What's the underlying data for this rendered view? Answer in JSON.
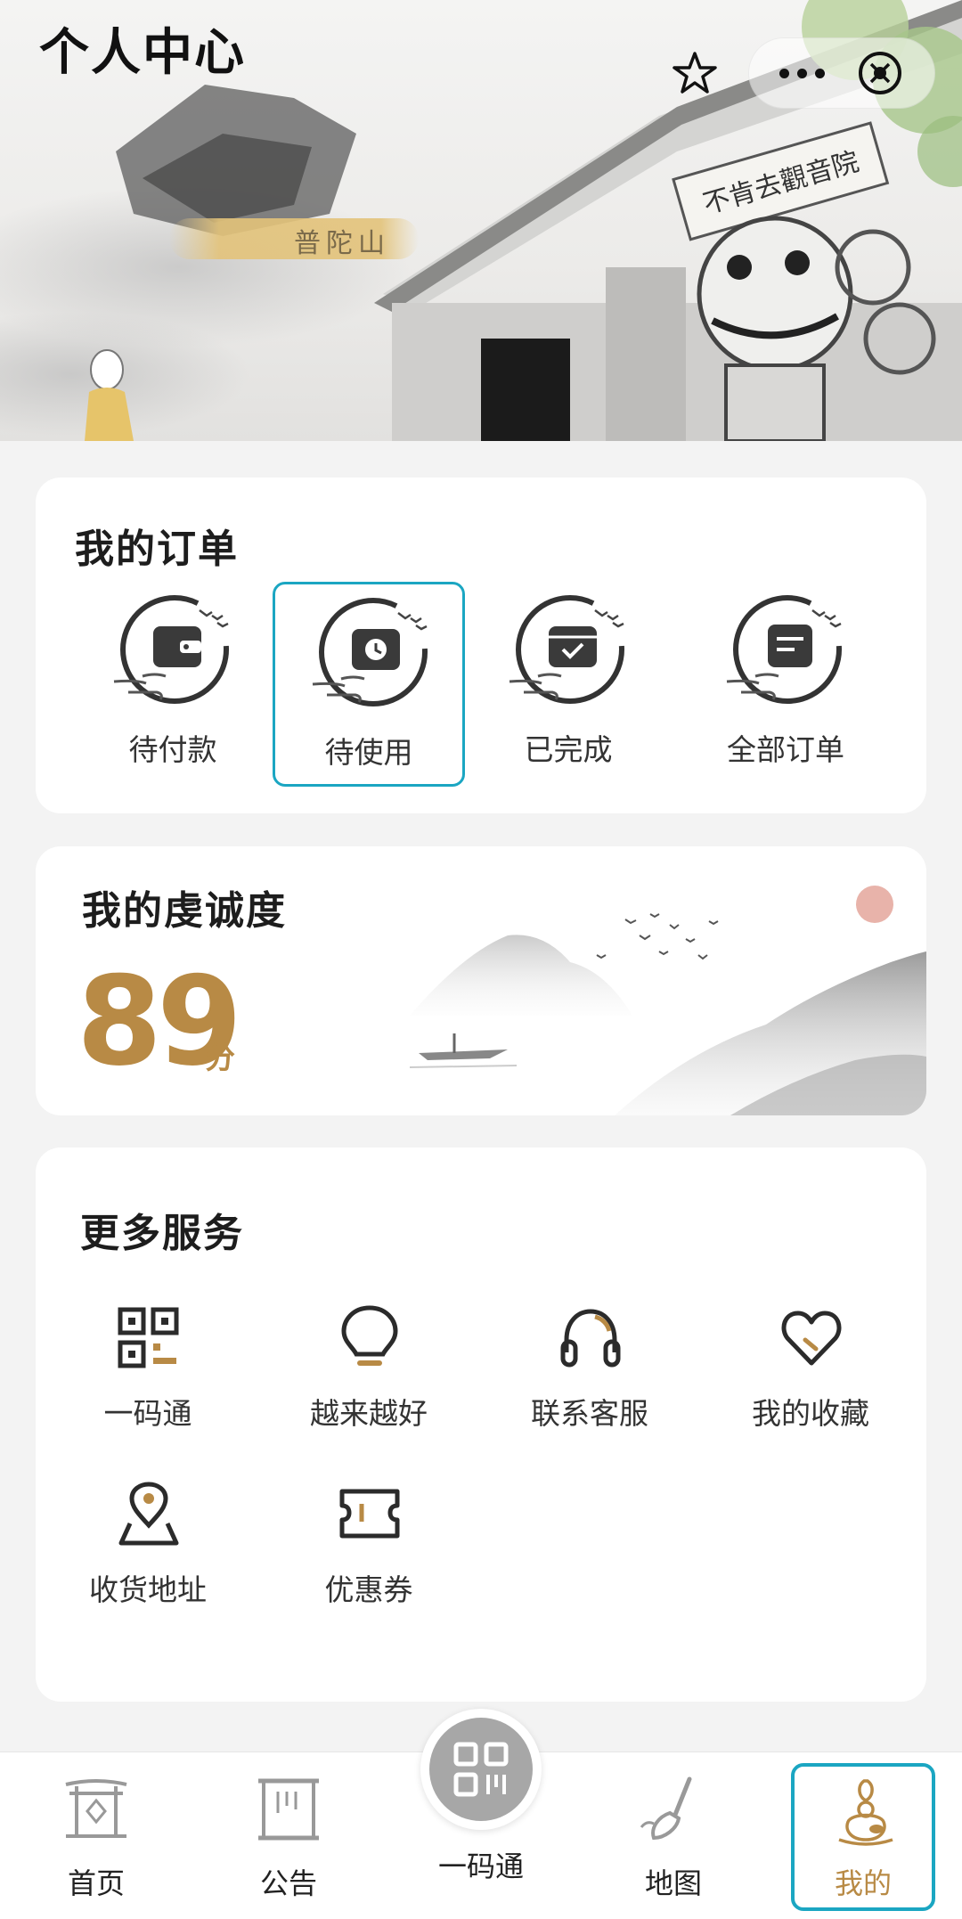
{
  "header": {
    "title": "个人中心",
    "banner_text": "普陀山",
    "banner_plaque": "不肯去觀音院",
    "icons": [
      "star-icon",
      "more-icon",
      "close-icon"
    ]
  },
  "orders": {
    "title": "我的订单",
    "items": [
      {
        "label": "待付款",
        "icon": "wallet-icon",
        "selected": false
      },
      {
        "label": "待使用",
        "icon": "clock-icon",
        "selected": true
      },
      {
        "label": "已完成",
        "icon": "check-icon",
        "selected": false
      },
      {
        "label": "全部订单",
        "icon": "document-icon",
        "selected": false
      }
    ]
  },
  "devotion": {
    "title": "我的虔诚度",
    "score": "89",
    "unit": "分"
  },
  "services": {
    "title": "更多服务",
    "items": [
      {
        "label": "一码通",
        "icon": "qr-code-icon"
      },
      {
        "label": "越来越好",
        "icon": "lightbulb-icon"
      },
      {
        "label": "联系客服",
        "icon": "headphones-icon"
      },
      {
        "label": "我的收藏",
        "icon": "heart-icon"
      },
      {
        "label": "收货地址",
        "icon": "location-pin-icon"
      },
      {
        "label": "优惠券",
        "icon": "coupon-icon"
      }
    ]
  },
  "tabbar": {
    "items": [
      {
        "label": "首页",
        "icon": "gate-icon",
        "active": false
      },
      {
        "label": "公告",
        "icon": "scroll-icon",
        "active": false
      },
      {
        "label": "一码通",
        "icon": "qr-code-icon",
        "active": false
      },
      {
        "label": "地图",
        "icon": "brush-icon",
        "active": false
      },
      {
        "label": "我的",
        "icon": "buddha-icon",
        "active": true
      }
    ]
  },
  "colors": {
    "accent_gold": "#b88a45",
    "selection_teal": "#1ba6c2",
    "page_bg": "#f3f3f3"
  }
}
